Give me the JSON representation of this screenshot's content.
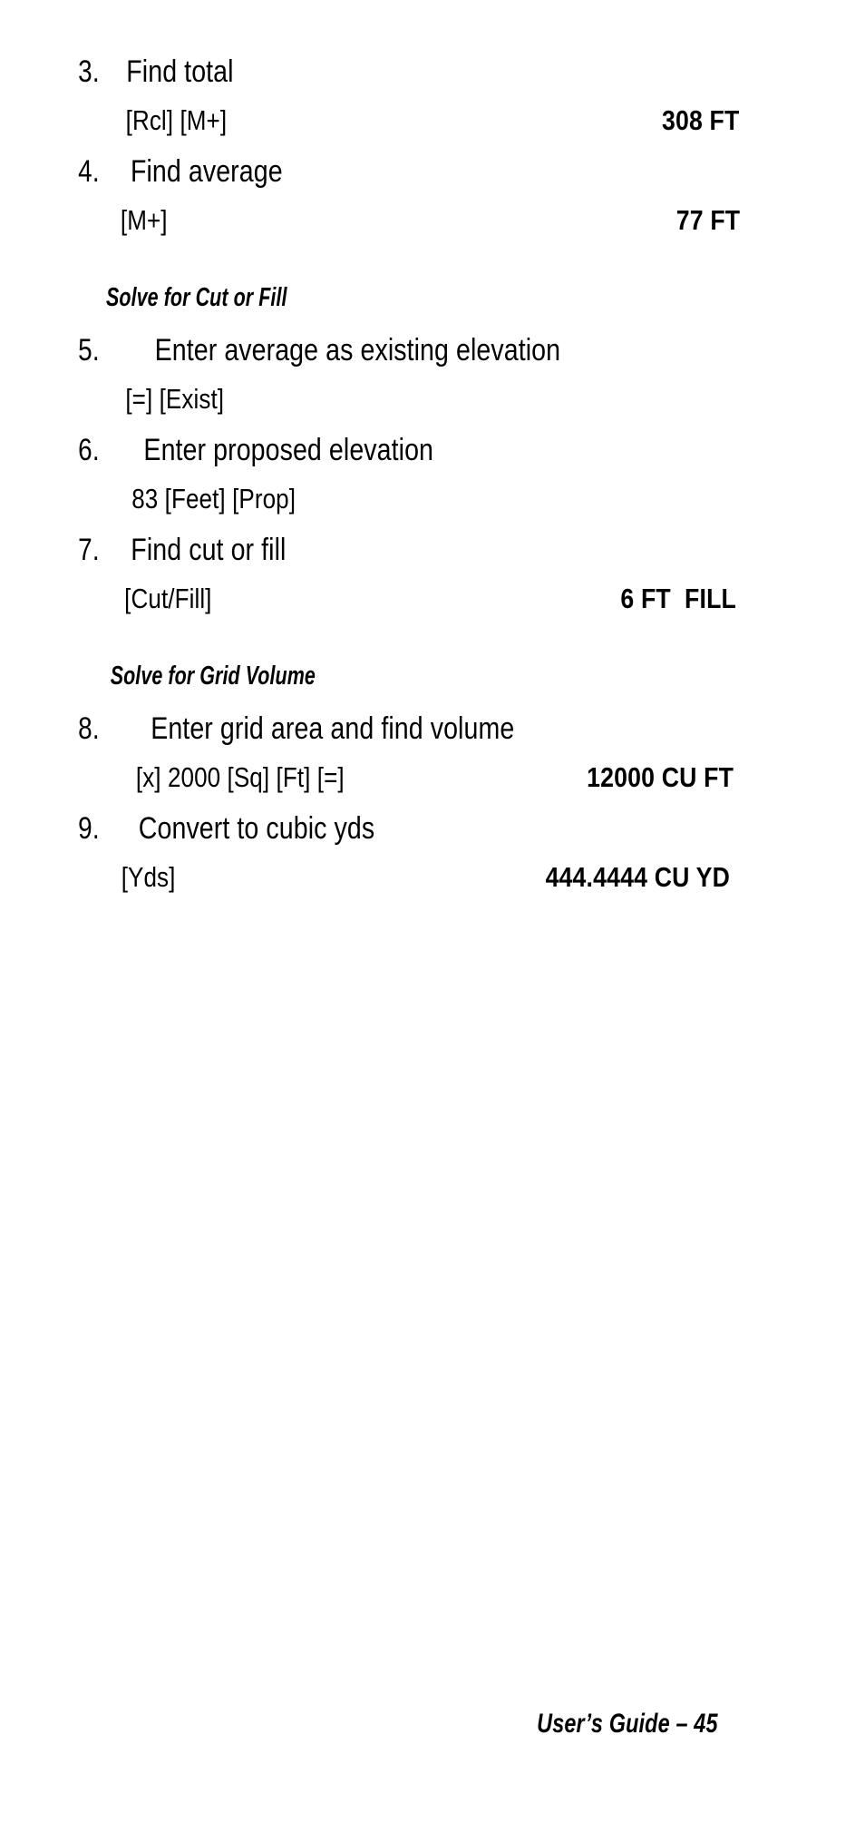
{
  "document": {
    "type": "user-guide-page",
    "page_number": "45",
    "footer_text": "User’s Guide – 45",
    "text_color": "#000000",
    "background_color": "#ffffff"
  },
  "blocks": [
    {
      "kind": "step",
      "number": "3.",
      "label": "Find total",
      "keys": "[Rcl] [M+]",
      "result": "308 FT"
    },
    {
      "kind": "step",
      "number": "4.",
      "label": "Find average",
      "keys": "[M+]",
      "result": "77 FT"
    },
    {
      "kind": "heading",
      "title": "Solve for Cut or Fill"
    },
    {
      "kind": "step",
      "number": "5.",
      "label": "Enter average as existing elevation",
      "keys": "[=] [Exist]",
      "result": ""
    },
    {
      "kind": "step",
      "number": "6.",
      "label": "Enter proposed elevation",
      "keys": "83 [Feet] [Prop]",
      "result": ""
    },
    {
      "kind": "step",
      "number": "7.",
      "label": "Find cut or fill",
      "keys": "[Cut/Fill]",
      "result": "6 FT  FILL"
    },
    {
      "kind": "heading",
      "title": "Solve for Grid Volume"
    },
    {
      "kind": "step",
      "number": "8.",
      "label": "Enter grid area and find volume",
      "keys": "[x] 2000 [Sq] [Ft] [=]",
      "result": "12000 CU FT"
    },
    {
      "kind": "step",
      "number": "9.",
      "label": "Convert to cubic yds",
      "keys": "[Yds]",
      "result": "444.4444 CU YD"
    }
  ]
}
